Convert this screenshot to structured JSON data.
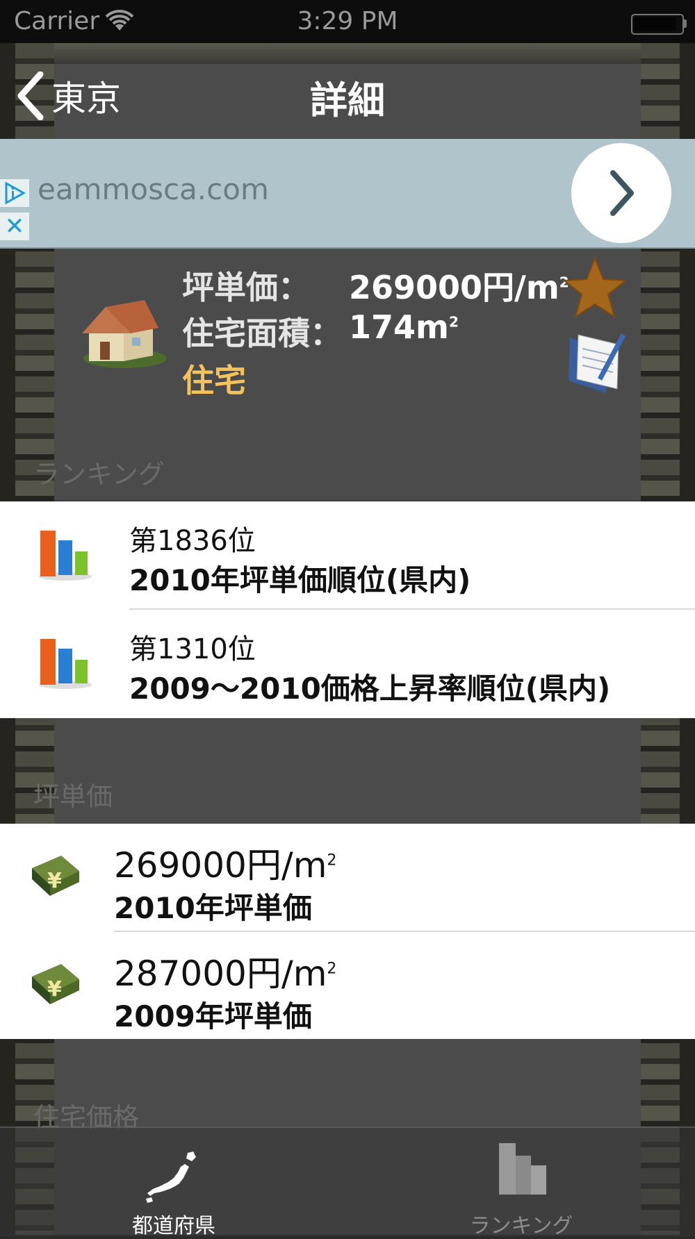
{
  "status_bar": {
    "carrier": "Carrier",
    "time": "3:29 PM"
  },
  "nav": {
    "back_label": "東京",
    "title": "詳細"
  },
  "ad": {
    "domain": "eammosca.com",
    "close_glyph": "✕",
    "arrow_glyph": "›"
  },
  "summary": {
    "unit_price_label": "坪単価：",
    "unit_price_value": "269000円/m",
    "area_label": "住宅面積：",
    "area_value": "174m",
    "superscript": "2",
    "type_label": "住宅",
    "colors": {
      "type": "#f5c35c",
      "star": "#a4661a"
    }
  },
  "sections": {
    "ranking": "ランキング",
    "unit_price": "坪単価",
    "housing_price": "住宅価格"
  },
  "ranking_rows": [
    {
      "rank": "第1836位",
      "title": "2010年坪単価順位(県内)"
    },
    {
      "rank": "第1310位",
      "title": "2009～2010価格上昇率順位(県内)"
    }
  ],
  "price_rows": [
    {
      "value": "269000円/m",
      "sup": "2",
      "title": "2010年坪単価"
    },
    {
      "value": "287000円/m",
      "sup": "2",
      "title": "2009年坪単価"
    }
  ],
  "tab_bar": {
    "tabs": [
      {
        "label": "都道府県",
        "icon": "japan-map-icon",
        "selected": true
      },
      {
        "label": "ランキング",
        "icon": "buildings-icon",
        "selected": false
      }
    ]
  }
}
